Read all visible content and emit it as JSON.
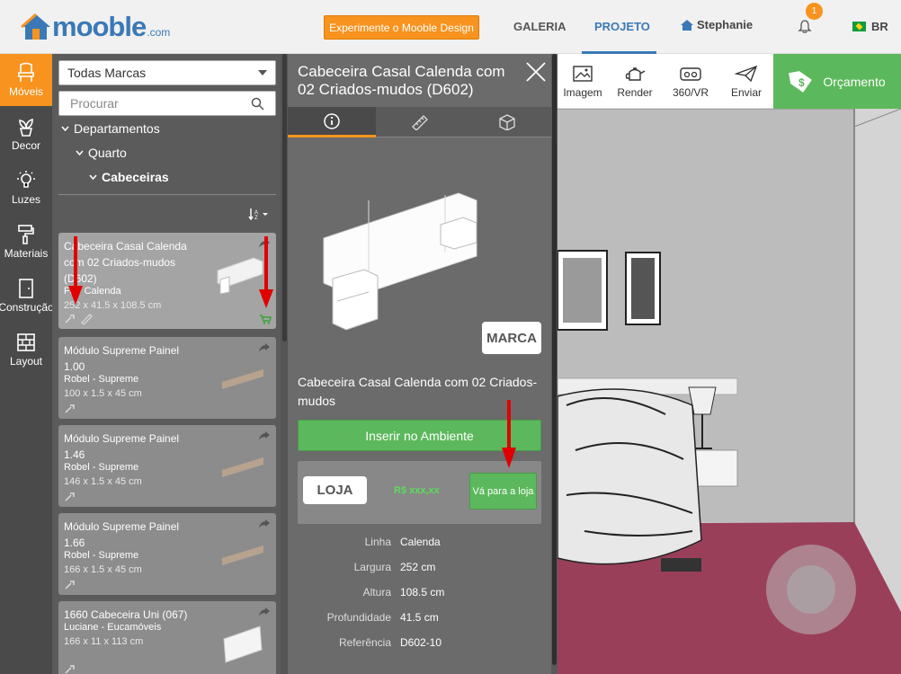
{
  "header": {
    "logo_text": "mooble",
    "logo_suffix": ".com",
    "experiment_button": "Experimente o Mooble Design",
    "nav": [
      "GALERIA",
      "PROJETO"
    ],
    "user_name": "Stephanie",
    "notification_count": "1",
    "language": "BR"
  },
  "sidebar": {
    "items": [
      {
        "label": "Móveis",
        "icon": "chair-icon"
      },
      {
        "label": "Decor",
        "icon": "plant-icon"
      },
      {
        "label": "Luzes",
        "icon": "lightbulb-icon"
      },
      {
        "label": "Materiais",
        "icon": "paint-roller-icon"
      },
      {
        "label": "Construção",
        "icon": "door-icon"
      },
      {
        "label": "Layout",
        "icon": "brick-wall-icon"
      }
    ]
  },
  "catalog": {
    "brand_filter": "Todas Marcas",
    "search_placeholder": "Procurar",
    "tree": [
      "Departamentos",
      "Quarto",
      "Cabeceiras"
    ],
    "products": [
      {
        "name": "Cabeceira Casal Calenda com 02 Criados-mudos (D602)",
        "brand": "Fa - Calenda",
        "dims": "252 x 41.5 x 108.5 cm"
      },
      {
        "name": "Módulo Supreme Painel 1.00",
        "brand": "Robel - Supreme",
        "dims": "100 x 1.5 x 45 cm"
      },
      {
        "name": "Módulo Supreme Painel 1.46",
        "brand": "Robel - Supreme",
        "dims": "146 x 1.5 x 45 cm"
      },
      {
        "name": "Módulo Supreme Painel 1.66",
        "brand": "Robel - Supreme",
        "dims": "166 x 1.5 x 45 cm"
      },
      {
        "name": "1660 Cabeceira Uni (067)",
        "brand": "Luciane - Eucamóveis",
        "dims": "166 x 11 x 113 cm"
      }
    ]
  },
  "detail": {
    "title": "Cabeceira Casal Calenda com 02 Criados-mudos (D602)",
    "brand_badge": "MARCA",
    "name": "Cabeceira Casal Calenda com 02 Criados-mudos",
    "insert_button": "Inserir no Ambiente",
    "store_badge": "LOJA",
    "price": "R$ xxx,xx",
    "goto_store_button": "Vá para a loja",
    "specs": [
      {
        "key": "Linha",
        "value": "Calenda"
      },
      {
        "key": "Largura",
        "value": "252 cm"
      },
      {
        "key": "Altura",
        "value": "108.5 cm"
      },
      {
        "key": "Profundidade",
        "value": "41.5 cm"
      },
      {
        "key": "Referência",
        "value": "D602-10"
      }
    ]
  },
  "toolbar": {
    "tools": [
      "Imagem",
      "Render",
      "360/VR",
      "Enviar"
    ],
    "quote_button": "Orçamento"
  },
  "colors": {
    "accent": "#f7931e",
    "brand_blue": "#3a79b6",
    "green": "#5cb85c",
    "arrow_red": "#e00000"
  }
}
